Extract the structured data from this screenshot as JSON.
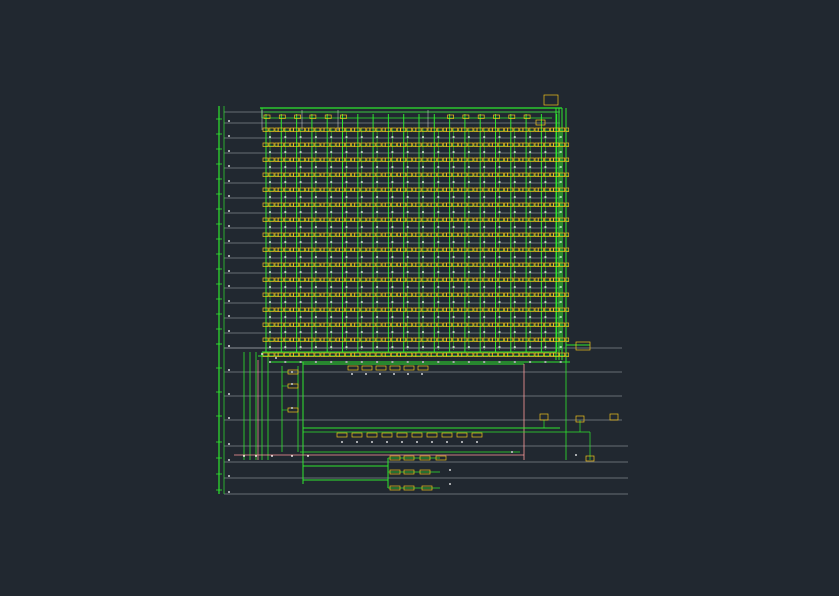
{
  "colors": {
    "background": "#212830",
    "pipe": "#2ee62e",
    "floor_line": "#b0b4b8",
    "fixture": "#f2c21b",
    "label": "#ffffff",
    "return_line": "#ff9a9a"
  },
  "drawing": {
    "type": "water-supply-riser-system-diagram",
    "floor_levels_upper": 16,
    "floor_levels_lower": 8,
    "risers_per_group": 10,
    "riser_groups": 2,
    "fixtures_per_riser_per_floor": 1
  }
}
